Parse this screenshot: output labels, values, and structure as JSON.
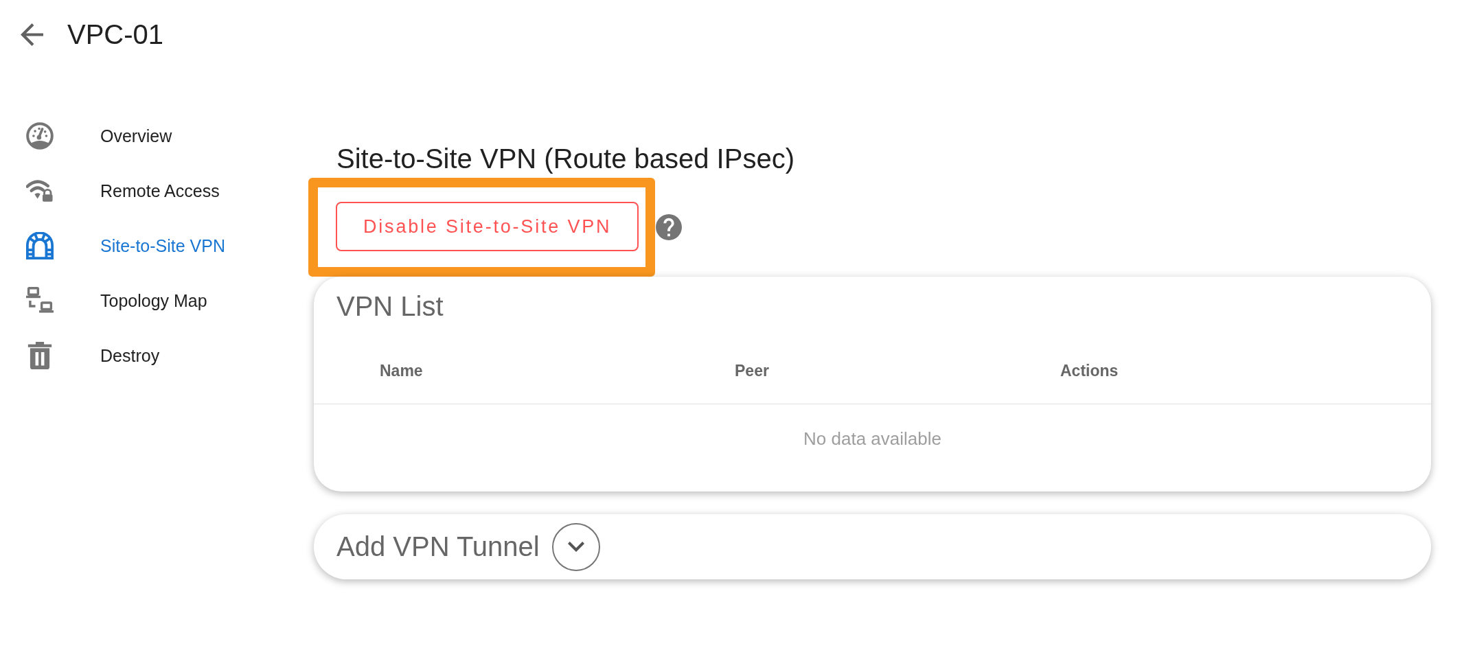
{
  "header": {
    "title": "VPC-01"
  },
  "sidebar": {
    "items": [
      {
        "label": "Overview",
        "selected": false
      },
      {
        "label": "Remote Access",
        "selected": false
      },
      {
        "label": "Site-to-Site VPN",
        "selected": true
      },
      {
        "label": "Topology Map",
        "selected": false
      },
      {
        "label": "Destroy",
        "selected": false
      }
    ]
  },
  "main": {
    "title": "Site-to-Site VPN (Route based IPsec)",
    "disable_button": {
      "label": "Disable Site-to-Site VPN",
      "highlighted": true
    }
  },
  "vpn_list": {
    "title": "VPN List",
    "columns": [
      "Name",
      "Peer",
      "Actions"
    ],
    "empty_text": "No data available"
  },
  "add_tunnel": {
    "title": "Add VPN Tunnel",
    "expanded": false
  }
}
